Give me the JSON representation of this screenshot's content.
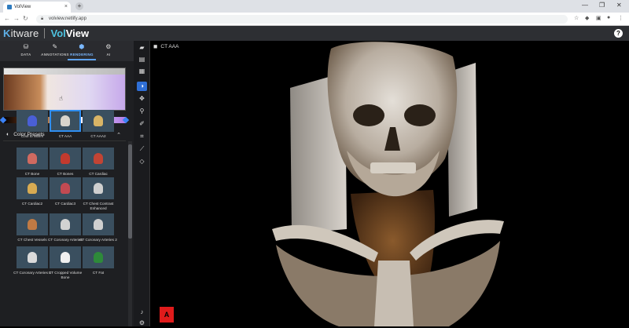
{
  "browser": {
    "tab_title": "VolView",
    "new_tab": "+",
    "url": "volview.netlify.app",
    "min": "—",
    "max": "❐",
    "close": "✕"
  },
  "app": {
    "logo_kitware": "itware",
    "logo_k": "K",
    "logo_vol": "Vol",
    "logo_view": "View",
    "help": "?"
  },
  "nav_tabs": [
    {
      "label": "DATA",
      "icon": "database-icon"
    },
    {
      "label": "ANNOTATIONS",
      "icon": "pencil-icon"
    },
    {
      "label": "RENDERING",
      "icon": "cube-icon"
    },
    {
      "label": "AI",
      "icon": "robot-icon"
    }
  ],
  "presets": {
    "title": "Color Presets",
    "items": [
      {
        "label": "Cool to Warm",
        "color": "#4a5fd6"
      },
      {
        "label": "CT AAA",
        "color": "#d9d4cc"
      },
      {
        "label": "CT AAA2",
        "color": "#d8b466"
      },
      {
        "label": "CT Bone",
        "color": "#d06a60"
      },
      {
        "label": "CT Bones",
        "color": "#c23a2e"
      },
      {
        "label": "CT Cardiac",
        "color": "#c24434"
      },
      {
        "label": "CT Cardiac2",
        "color": "#d8ab52"
      },
      {
        "label": "CT Cardiac3",
        "color": "#c24a52"
      },
      {
        "label": "CT Chest Contrast Enhanced",
        "color": "#cfcfcf"
      },
      {
        "label": "CT Chest Vessels",
        "color": "#c07a44"
      },
      {
        "label": "CT Coronary Arteries",
        "color": "#d2d2d2"
      },
      {
        "label": "CT Coronary Arteries 2",
        "color": "#cfcfcf"
      },
      {
        "label": "CT Coronary Arteries 3",
        "color": "#dadada"
      },
      {
        "label": "CT Cropped Volume Bone",
        "color": "#f0f0f0"
      },
      {
        "label": "CT Fat",
        "color": "#2e8a3a"
      }
    ]
  },
  "viewer": {
    "title": "CT AAA",
    "badge": "A"
  }
}
